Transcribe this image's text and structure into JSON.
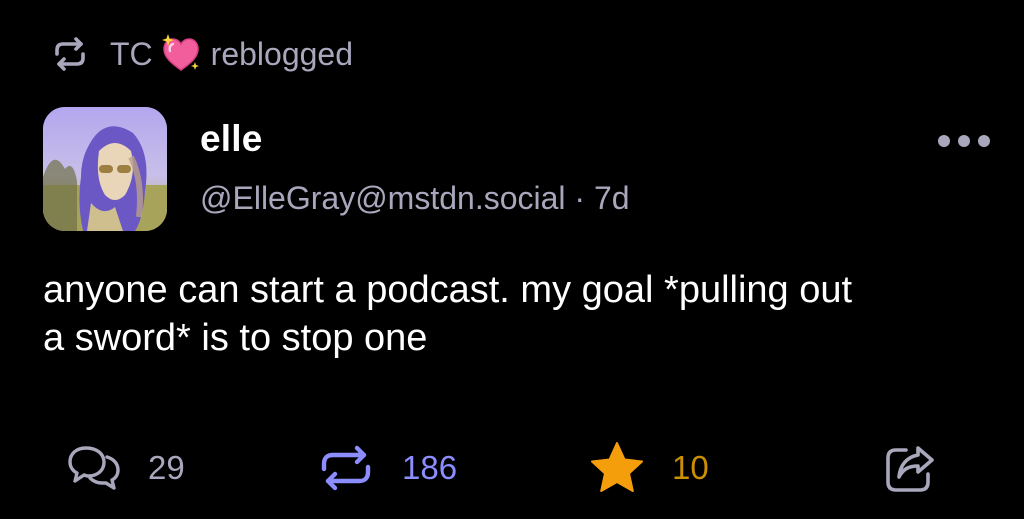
{
  "reblog": {
    "booster_name": "TC",
    "emoji_icon": "sparkling-heart-icon",
    "action_text": "reblogged"
  },
  "author": {
    "display_name": "elle",
    "handle": "@ElleGray@mstdn.social",
    "separator": "·",
    "age": "7d",
    "avatar_icon": "user-avatar"
  },
  "content": {
    "line1": "anyone can start a podcast. my goal *pulling out",
    "line2": "a sword* is to stop one"
  },
  "actions": {
    "replies": "29",
    "boosts": "186",
    "favourites": "10"
  },
  "colors": {
    "background": "#000000",
    "text": "#ffffff",
    "muted": "#a9a7bc",
    "boost_active": "#8c8dff",
    "favourite_active": "#ca8f04"
  }
}
